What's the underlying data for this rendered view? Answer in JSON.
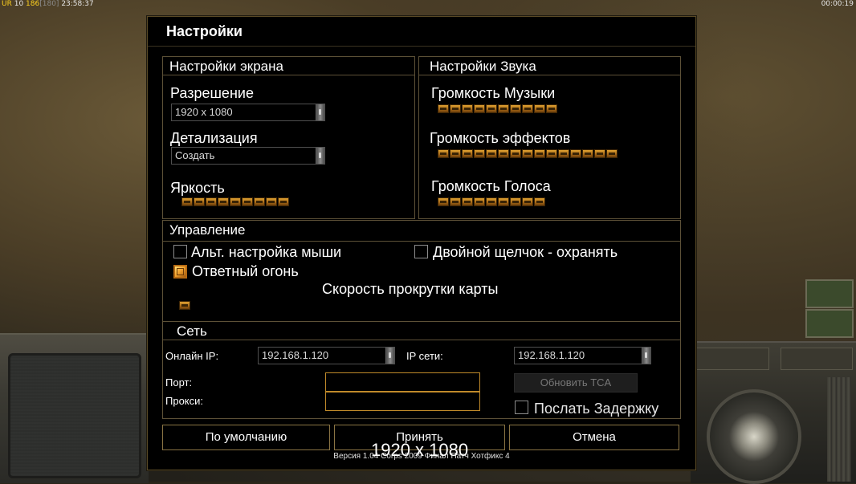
{
  "hud": {
    "ur": "UR",
    "value1": "10",
    "value2": "186",
    "bracket": "[180]",
    "clock": "23:58:37",
    "timer": "00:00:19"
  },
  "dialog": {
    "title": "Настройки",
    "screen": {
      "header": "Настройки экрана",
      "resolution_label": "Разрешение",
      "resolution_value": "1920 x 1080",
      "detail_label": "Детализация",
      "detail_value": "Создать",
      "brightness_label": "Яркость",
      "brightness_level": 9
    },
    "sound": {
      "header": "Настройки Звука",
      "music_label": "Громкость Музыки",
      "music_level": 10,
      "effects_label": "Громкость эффектов",
      "effects_level": 15,
      "voice_label": "Громкость Голоса",
      "voice_level": 9
    },
    "controls": {
      "header": "Управление",
      "alt_mouse_label": "Альт. настройка мыши",
      "alt_mouse_checked": false,
      "double_click_label": "Двойной щелчок - охранять",
      "double_click_checked": false,
      "return_fire_label": "Ответный огонь",
      "return_fire_checked": true,
      "scroll_speed_label": "Скорость прокрутки карты",
      "scroll_speed_level": 1
    },
    "network": {
      "header": "Сеть",
      "online_ip_label": "Онлайн IP:",
      "online_ip_value": "192.168.1.120",
      "net_ip_label": "IP сети:",
      "net_ip_value": "192.168.1.120",
      "port_label": "Порт:",
      "port_value": "",
      "proxy_label": "Прокси:",
      "proxy_value": "",
      "refresh_tca_label": "Обновить TCA",
      "send_delay_label": "Послать Задержку",
      "send_delay_checked": false
    },
    "buttons": {
      "default_label": "По умолчанию",
      "accept_label": "Принять",
      "cancel_label": "Отмена"
    },
    "version_text": "Версия 1.04 Corps 2009 Финал Патч Хотфикс 4",
    "overlay_resolution": "1920 x 1080"
  },
  "colors": {
    "accent": "#c08a2a",
    "slider_fill": "#e0a232",
    "frame": "#5d5137"
  }
}
